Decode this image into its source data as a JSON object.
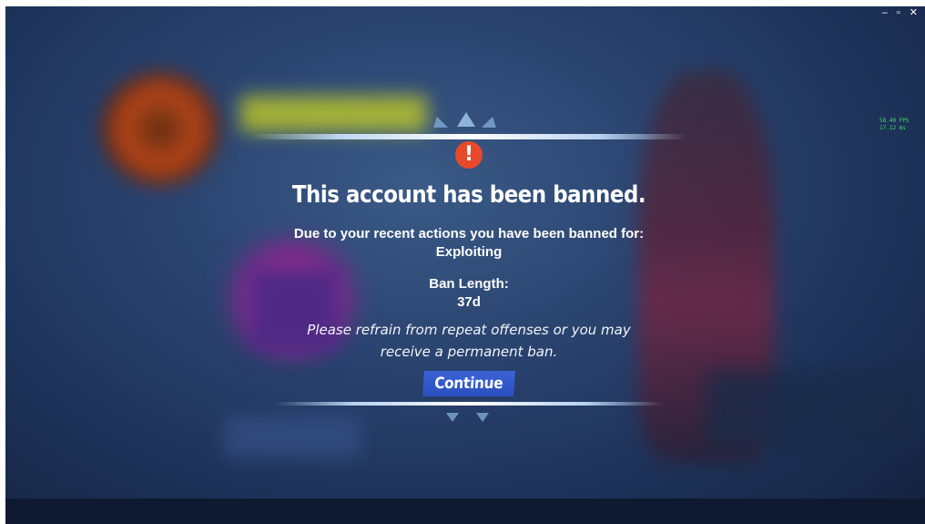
{
  "window": {
    "controls": {
      "minimize": "–",
      "maximize": "▫",
      "close": "✕"
    }
  },
  "fps_overlay": {
    "fps": "58.40 FPS",
    "ms": "17.12 ms"
  },
  "modal": {
    "icon": "exclamation-icon",
    "title": "This account has been banned.",
    "reason_line": "Due to your recent actions you have been banned for:",
    "reason_value": "Exploiting",
    "ban_length_label": "Ban Length:",
    "ban_length_value": "37d",
    "warning": "Please refrain from repeat offenses or you may receive a permanent ban.",
    "continue_label": "Continue"
  },
  "colors": {
    "accent_button": "#2a4fbf",
    "alert_icon": "#e8492a",
    "fps_text": "#35e35a"
  }
}
